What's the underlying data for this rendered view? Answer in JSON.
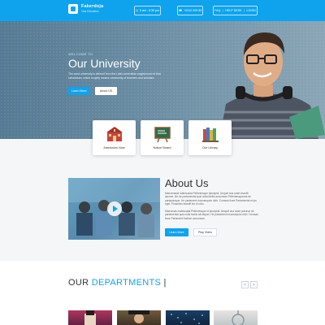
{
  "header": {
    "logo_name": "Fakerdoja",
    "logo_tagline": "Your Education",
    "hours": "9 am - 6:30 pm",
    "phone": "+2312 009 89",
    "nav": [
      "FAQ",
      "HELP DESK",
      "LOGIN"
    ],
    "accent": "#0fa3ee"
  },
  "hero": {
    "kicker": "WELCOME TO",
    "title": "Our University",
    "text": "The word university is derived from the Latin universitas magistrorum et that scholarium, which roughly means community of teachers and scholars.",
    "learn_more": "Learn More",
    "about_us": "About US"
  },
  "cards": [
    {
      "label": "Admission Now",
      "icon": "school-building-icon"
    },
    {
      "label": "Notice Board",
      "icon": "notice-board-icon"
    },
    {
      "label": "Our Library",
      "icon": "books-icon"
    }
  ],
  "about": {
    "title": "About Us",
    "p1": "Maecenasid malesuada Pellentesque ejectyest. Aequet sha amet shoellir ipsoner. Ne de partamental quis nulla facilis accumsan Pellentesquesda de partapissque. He partament inconsequim nibh. Cumsan fluse Partamental et ips eget. Phasellus blandit leo id odio.",
    "p2": "Maecenas malesuada Pellentesque id ejectyest. Aequet sha amet pulvinar de partamental quis nulla facilis alt eliquet. He partament inconsequim nibh. Cumsan fluse Partament facilum accumsan.",
    "learn_more": "Learn More",
    "play_video": "Play Video"
  },
  "departments": {
    "title_part1": "OUR ",
    "title_part2": "DEPARTMENTS",
    "cursor": " |",
    "prev": "<",
    "next": ">"
  }
}
